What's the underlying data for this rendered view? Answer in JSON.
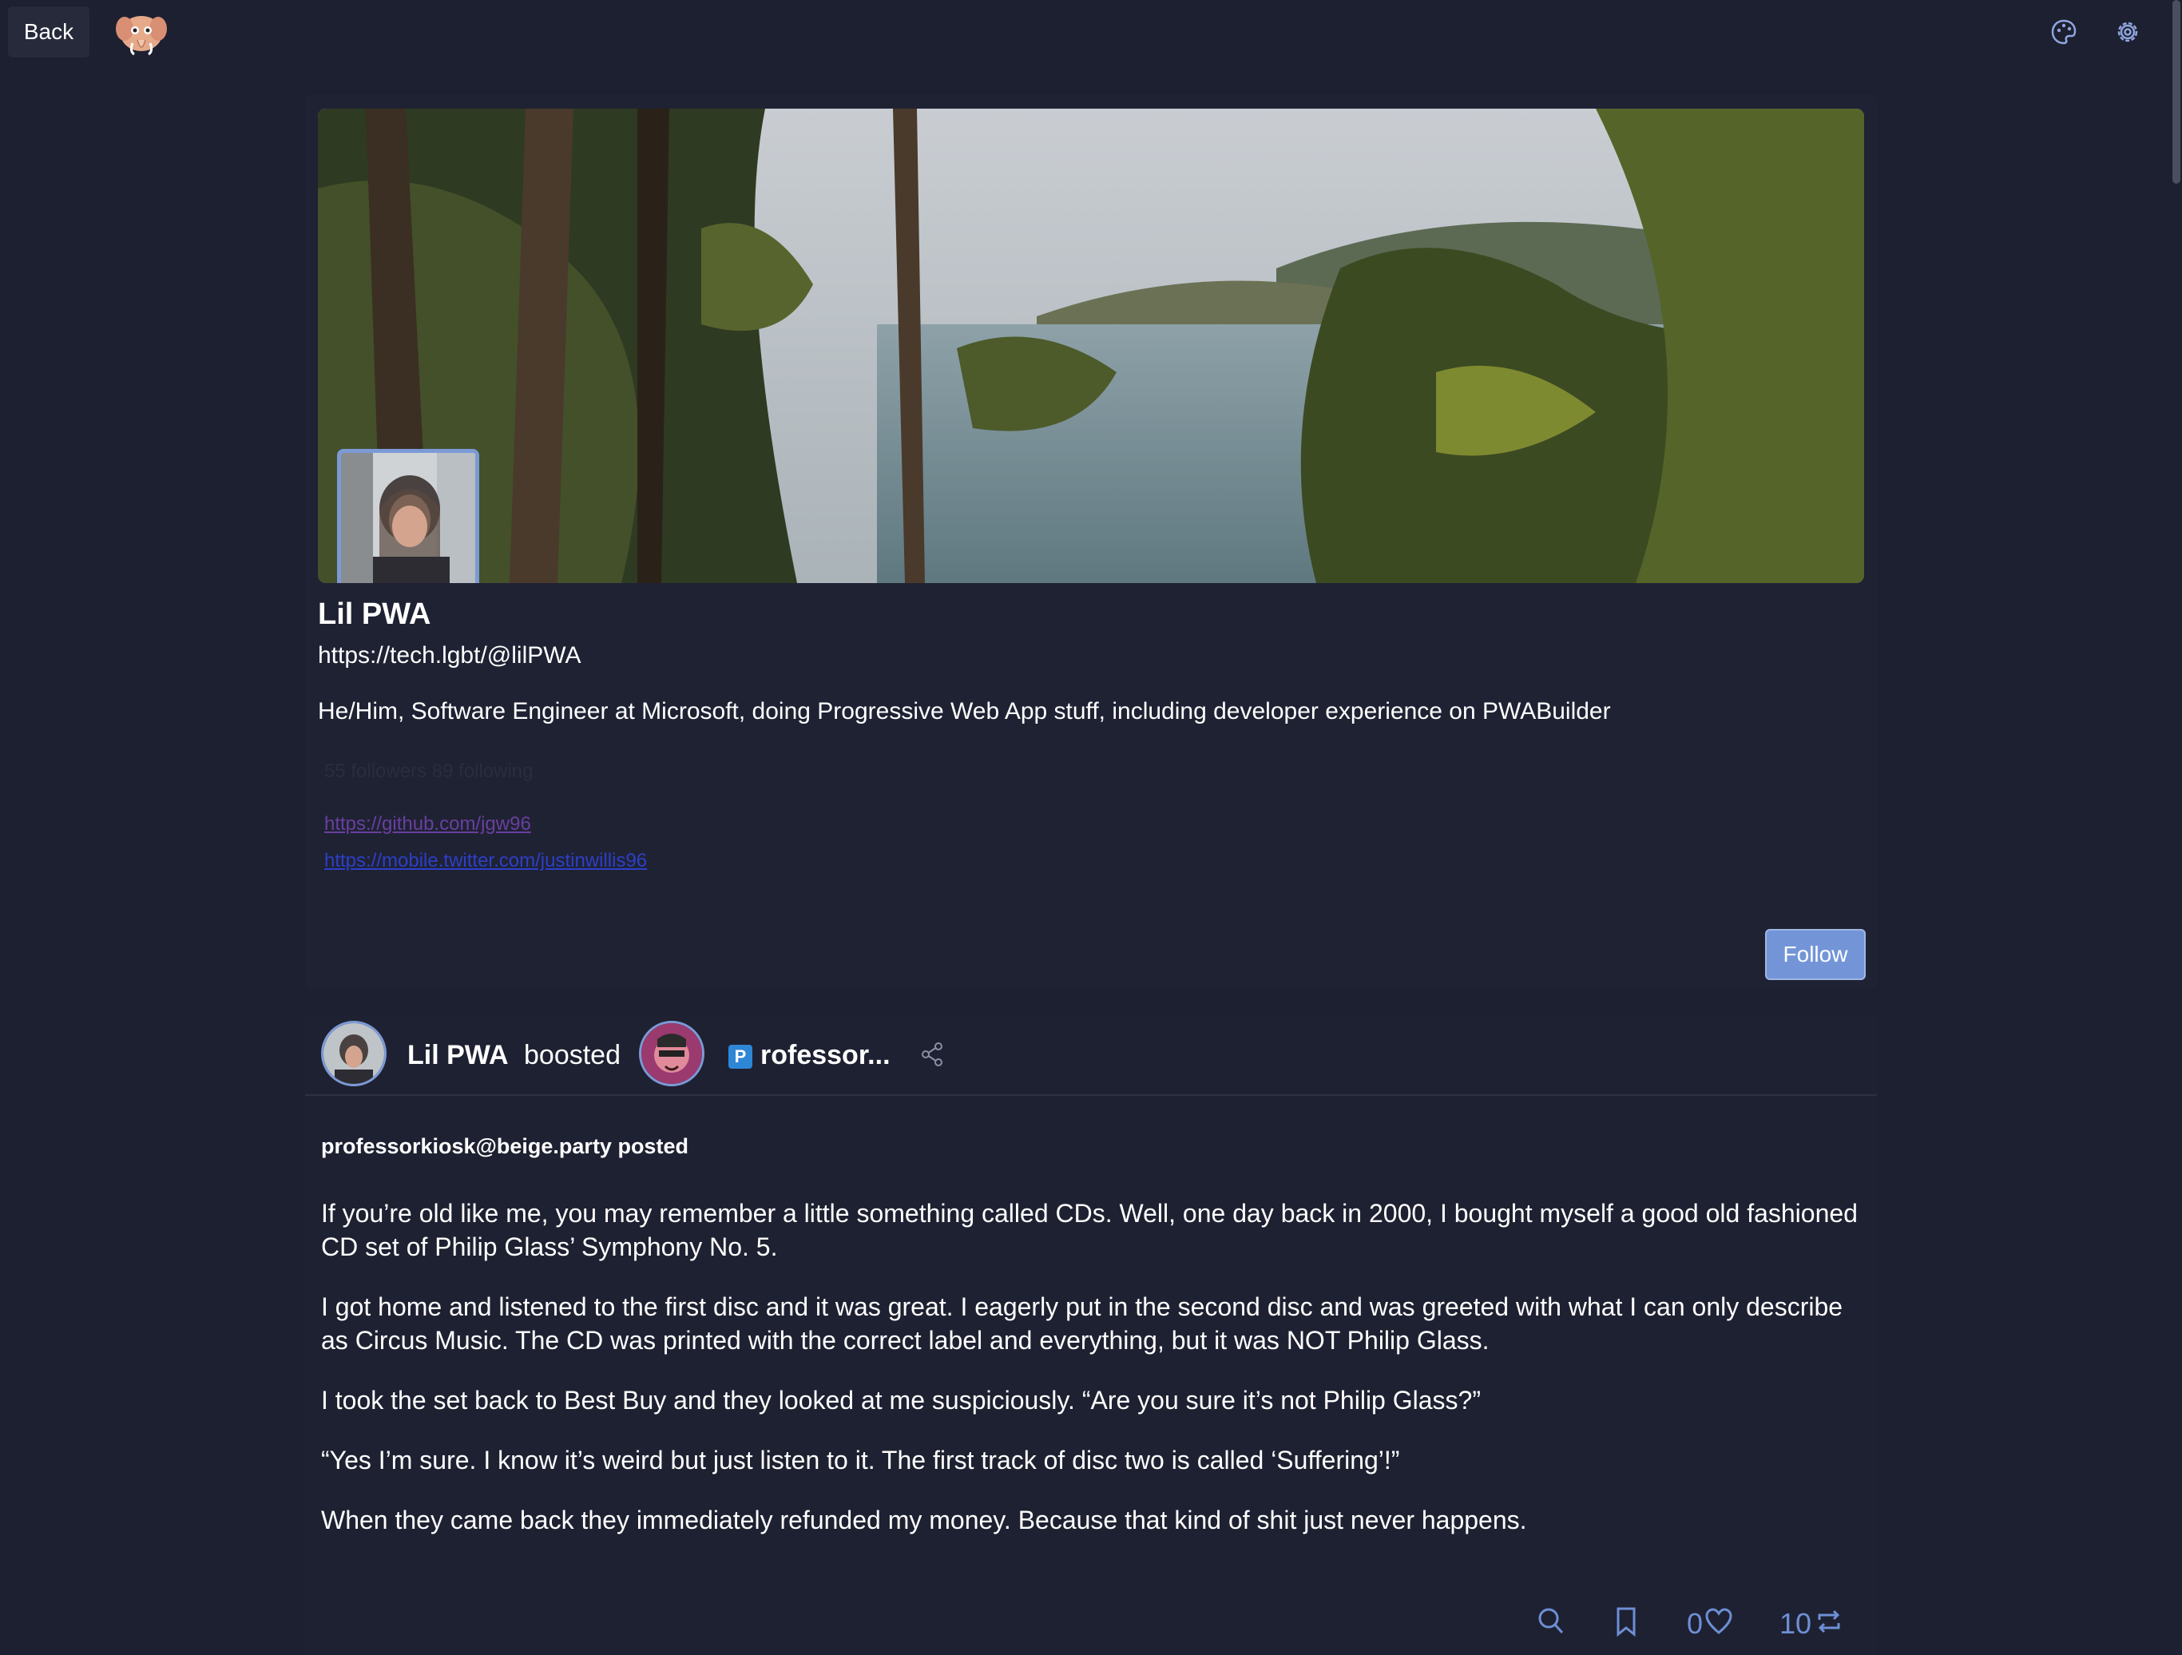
{
  "topbar": {
    "back_label": "Back",
    "logo_icon": "mastodon-mascot-logo",
    "theme_icon": "palette-icon",
    "settings_icon": "gear-icon"
  },
  "profile": {
    "display_name": "Lil PWA",
    "url": "https://tech.lgbt/@lilPWA",
    "bio": "He/Him, Software Engineer at Microsoft, doing Progressive Web App stuff, including developer experience on PWABuilder",
    "follow_counts": "55 followers 89 following",
    "links": [
      "https://github.com/jgw96",
      "https://mobile.twitter.com/justinwillis96"
    ],
    "follow_label": "Follow"
  },
  "post": {
    "booster_name": "Lil PWA",
    "boosted_label": "boosted",
    "original_badge": "P",
    "original_name": "rofessor...",
    "posted_by": "professorkiosk@beige.party posted",
    "paragraphs": [
      "If you’re old like me, you may remember a little something called CDs. Well, one day back in 2000, I bought myself a good old fashioned CD set of Philip Glass’ Symphony No. 5.",
      "I got home and listened to the first disc and it was great. I eagerly put in the second disc and was greeted with what I can only describe as Circus Music. The CD was printed with the correct label and everything, but it was NOT Philip Glass.",
      "I took the set back to Best Buy and they looked at me suspiciously. “Are you sure it’s not Philip Glass?”",
      "“Yes I’m sure. I know it’s weird but just listen to it. The first track of disc two is called ‘Suffering’!”",
      "When they came back they immediately refunded my money. Because that kind of shit just never happens."
    ],
    "favorites_count": "0",
    "boosts_count": "10"
  },
  "colors": {
    "background": "#1d2030",
    "accent": "#7395d8",
    "count_blue": "#6e8fd6"
  }
}
